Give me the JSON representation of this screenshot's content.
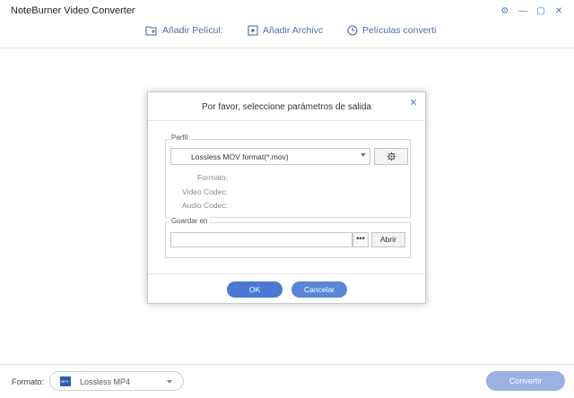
{
  "app": {
    "title": "NoteBurner Video Converter"
  },
  "window_controls": [
    {
      "name": "settings-icon",
      "glyph": "⚙"
    },
    {
      "name": "minimize-icon",
      "glyph": "—"
    },
    {
      "name": "maximize-icon",
      "glyph": "▢"
    },
    {
      "name": "close-icon",
      "glyph": "✕"
    }
  ],
  "toolbar": {
    "add_movie": "Añadir Películ:",
    "add_file": "Añadir Archivc",
    "converted": "Películas converti"
  },
  "dialog": {
    "title": "Por favor, seleccione parámetros de salida",
    "close_glyph": "✕",
    "profile": {
      "group_label": "Perfil",
      "selected": "Lossless MOV format(*.mov)",
      "info_labels": [
        "Formato:",
        "Video Codec:",
        "Audio Codec:"
      ]
    },
    "save": {
      "group_label": "Guardar en",
      "path_value": "",
      "browse_label": "•••",
      "open_label": "Abrir"
    },
    "ok_label": "OK",
    "cancel_label": "Cancelar"
  },
  "bottom": {
    "format_label": "Formato:",
    "format_icon_text": "MP4",
    "format_value": "Lossless MP4",
    "convert_label": "Convertir"
  },
  "colors": {
    "accent": "#4a78d2",
    "convert_disabled": "#9ab1e2",
    "toolbar_text": "#4a6ea9"
  }
}
